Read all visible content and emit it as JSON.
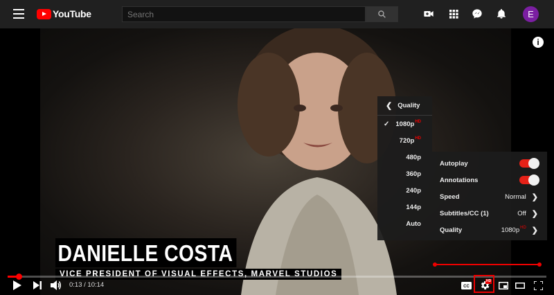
{
  "header": {
    "logo_text": "YouTube",
    "search": {
      "placeholder": "Search"
    },
    "avatar_letter": "E",
    "avatar_color": "#7b1fa2",
    "icons": [
      "menu-icon",
      "search-icon",
      "video-camera-plus-icon",
      "apps-grid-icon",
      "messages-icon",
      "bell-icon"
    ]
  },
  "video": {
    "lower_third": {
      "name": "DANIELLE COSTA",
      "title": "VICE PRESIDENT OF VISUAL EFFECTS, MARVEL STUDIOS"
    },
    "info_icon": "i"
  },
  "quality_menu": {
    "title": "Quality",
    "items": [
      {
        "label": "1080p",
        "hd": "HD",
        "selected": true
      },
      {
        "label": "720p",
        "hd": "HD",
        "selected": false
      },
      {
        "label": "480p",
        "hd": "",
        "selected": false
      },
      {
        "label": "360p",
        "hd": "",
        "selected": false
      },
      {
        "label": "240p",
        "hd": "",
        "selected": false
      },
      {
        "label": "144p",
        "hd": "",
        "selected": false
      },
      {
        "label": "Auto",
        "hd": "",
        "selected": false
      }
    ],
    "check_mark": "✓"
  },
  "settings_menu": {
    "autoplay": {
      "label": "Autoplay",
      "on": true
    },
    "annotations": {
      "label": "Annotations",
      "on": true
    },
    "speed": {
      "label": "Speed",
      "value": "Normal"
    },
    "subtitles": {
      "label": "Subtitles/CC (1)",
      "value": "Off"
    },
    "quality": {
      "label": "Quality",
      "value": "1080p",
      "hd": "HD"
    }
  },
  "controls": {
    "current_time": "0:13",
    "separator": " / ",
    "duration": "10:14",
    "progress": 0.021,
    "accent_color": "#ff0000",
    "gear_badge": "HD"
  }
}
